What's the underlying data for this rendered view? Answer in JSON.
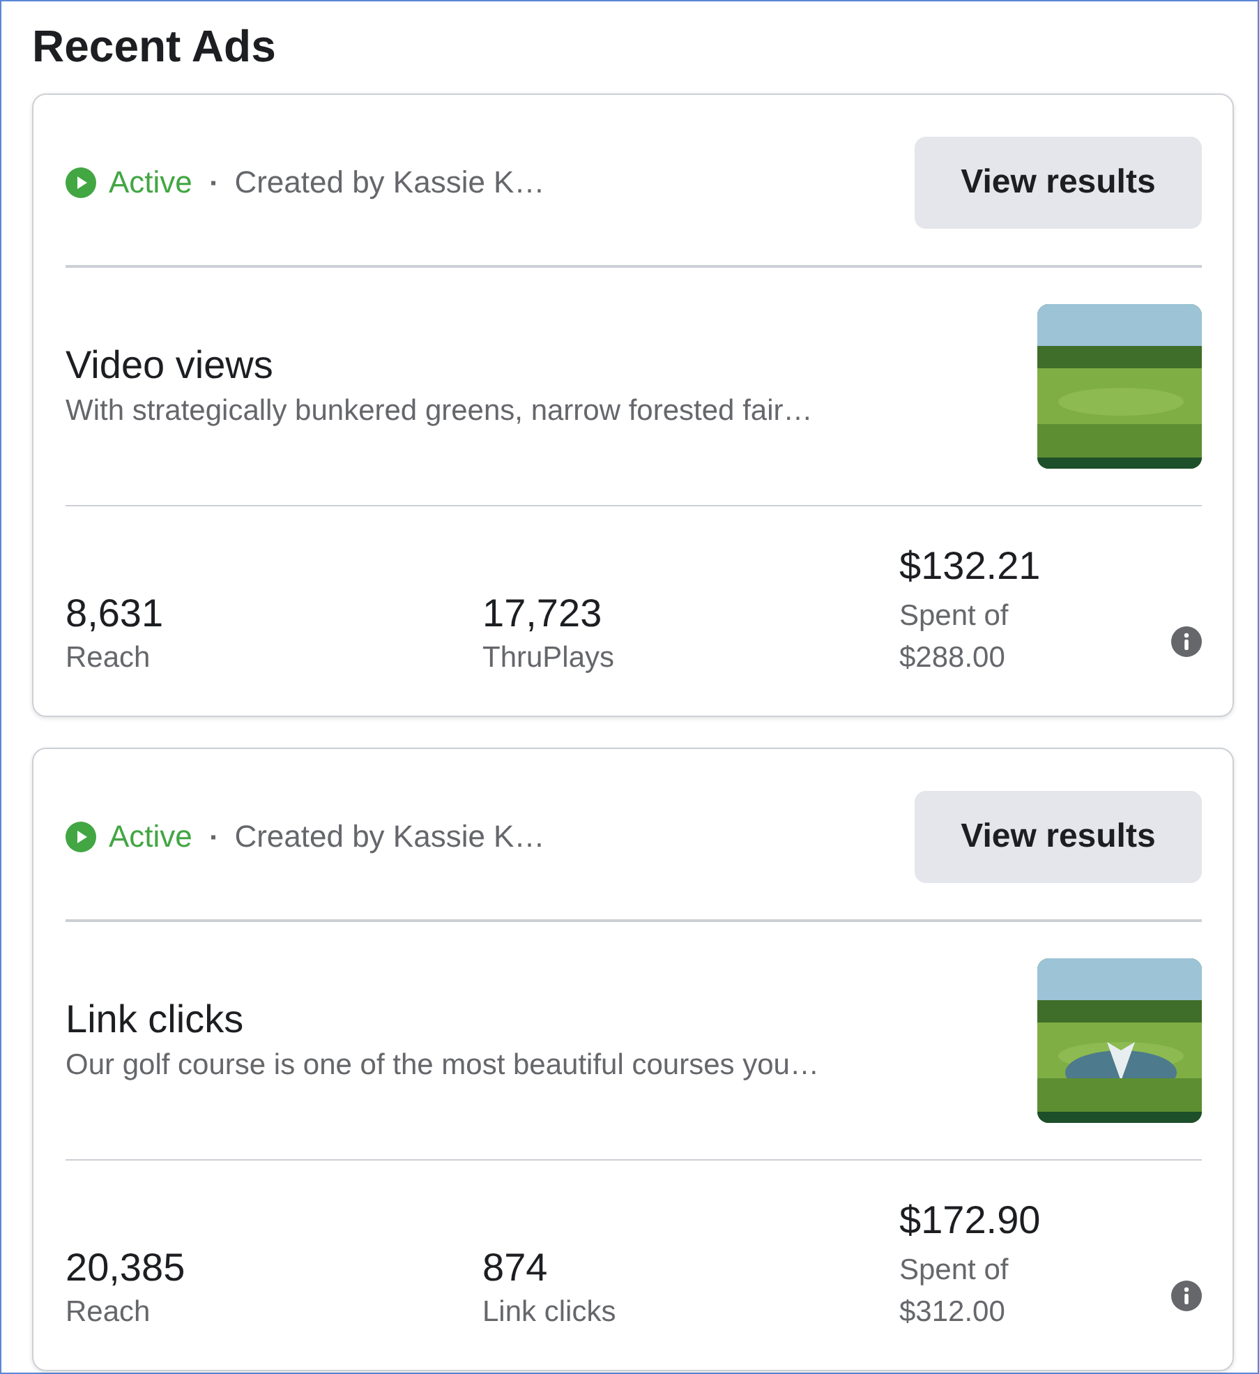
{
  "title": "Recent Ads",
  "ads": [
    {
      "status": {
        "label": "Active",
        "active": true
      },
      "separator": "▪",
      "creator": "Created by Kassie K…",
      "button": "View results",
      "objective": "Video views",
      "description": "With strategically bunkered greens, narrow forested fair…",
      "stats": [
        {
          "value": "8,631",
          "label": "Reach"
        },
        {
          "value": "17,723",
          "label": "ThruPlays"
        }
      ],
      "spend": {
        "value": "$132.21",
        "label": "Spent of",
        "budget": "$288.00"
      }
    },
    {
      "status": {
        "label": "Active",
        "active": true
      },
      "separator": "▪",
      "creator": "Created by Kassie K…",
      "button": "View results",
      "objective": "Link clicks",
      "description": "Our golf course is one of the most beautiful courses you…",
      "stats": [
        {
          "value": "20,385",
          "label": "Reach"
        },
        {
          "value": "874",
          "label": "Link clicks"
        }
      ],
      "spend": {
        "value": "$172.90",
        "label": "Spent of",
        "budget": "$312.00"
      }
    }
  ]
}
